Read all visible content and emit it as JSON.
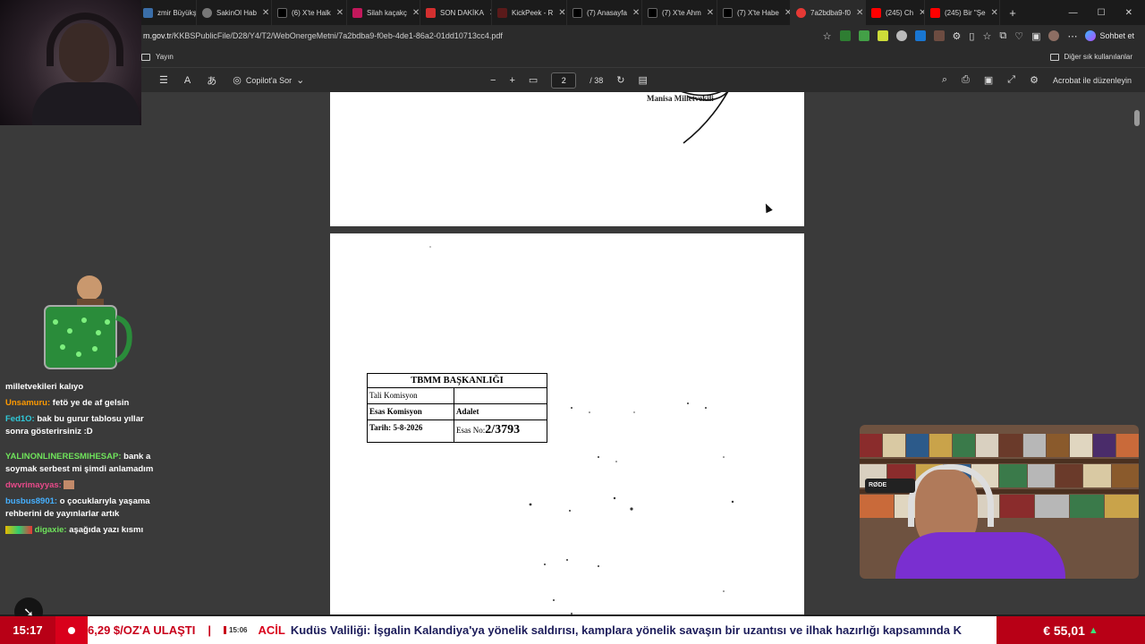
{
  "tabs": [
    {
      "label": "zmir Büyükş",
      "color": "#3a6ea8"
    },
    {
      "label": "SakinOl Hab",
      "color": "#777777"
    },
    {
      "label": "(6) X'te Halk",
      "color": "#000000"
    },
    {
      "label": "Silah kaçakç",
      "color": "#c2185b"
    },
    {
      "label": "SON DAKİKA",
      "color": "#d32f2f"
    },
    {
      "label": "KickPeek - R",
      "color": "#e0e0e0"
    },
    {
      "label": "(7) Anasayfa",
      "color": "#000000"
    },
    {
      "label": "(7) X'te Ahm",
      "color": "#000000"
    },
    {
      "label": "(7) X'te Habe",
      "color": "#000000"
    },
    {
      "label": "7a2bdba9-f0",
      "color": "#e53935",
      "active": true
    },
    {
      "label": "(245) Ch",
      "color": "#ff0000"
    },
    {
      "label": "(245) Bir \"Şe",
      "color": "#ff0000"
    }
  ],
  "new_tab": "+",
  "window_controls": [
    "—",
    "☐",
    "✕"
  ],
  "address": {
    "url_host": "m.gov.tr",
    "url_path": "/KKBSPublicFile/D28/Y4/T2/WebOnergeMetni/7a2bdba9-f0eb-4de1-86a2-01dd10713cc4.pdf"
  },
  "chat_button": "Sohbet et",
  "favorites": {
    "left": "Yayın",
    "right": "Diğer sık kullanılanlar"
  },
  "pdf_toolbar": {
    "copilot": "Copilot'a Sor",
    "page_current": "2",
    "page_total": "/ 38",
    "edit_with_acrobat": "Acrobat ile düzenleyin"
  },
  "pdf_page1": {
    "signature_caption": "Manisa Milletvekili"
  },
  "stamp": {
    "header": "TBMM BAŞKANLIĞI",
    "row1_label": "Tali Komisyon",
    "row1_value": "",
    "row2_label": "Esas Komisyon",
    "row2_value": "Adalet",
    "date_label": "Tarih:",
    "date_value": "5-8-2026",
    "no_label": "Esas No:",
    "no_value": "2/3793"
  },
  "chat_messages": [
    {
      "user": "",
      "text": "milletvekileri kalıyo",
      "color": "#ffffff"
    },
    {
      "user": "Unsamuru:",
      "text": "fetö ye de af gelsin",
      "color": "#ff9a00"
    },
    {
      "user": "Fed1O:",
      "text": "bak bu gurur tablosu yıllar sonra gösterirsiniz :D",
      "color": "#30c9d8"
    },
    {
      "user": "YALINONLINERESMIHESAP:",
      "text": "bank a soymak serbest mi şimdi anlamadım",
      "color": "#6fe35b"
    },
    {
      "user": "dwvrimayyas:",
      "text": "",
      "color": "#e84a8a"
    },
    {
      "user": "busbus8901:",
      "text": "o çocuklarıyla yaşama rehberini de yayınlarlar artık",
      "color": "#46b0ff"
    },
    {
      "user": "digaxie:",
      "text": "aşağıda yazı kısmı",
      "color": "#6fe35b"
    }
  ],
  "mic_label": "RØDE",
  "ticker": {
    "clock": "15:17",
    "prev_headline": "6,29 $/OZ'A ULAŞTI",
    "separator": "|",
    "time": "15:06",
    "tag": "ACİL",
    "headline": "Kudüs Valiliği: İşgalin Kalandiya'ya yönelik saldırısı, kamplara yönelik savaşın bir uzantısı ve ilhak hazırlığı kapsamında K",
    "euro": "€ 55,01",
    "euro_trend": "▲"
  }
}
